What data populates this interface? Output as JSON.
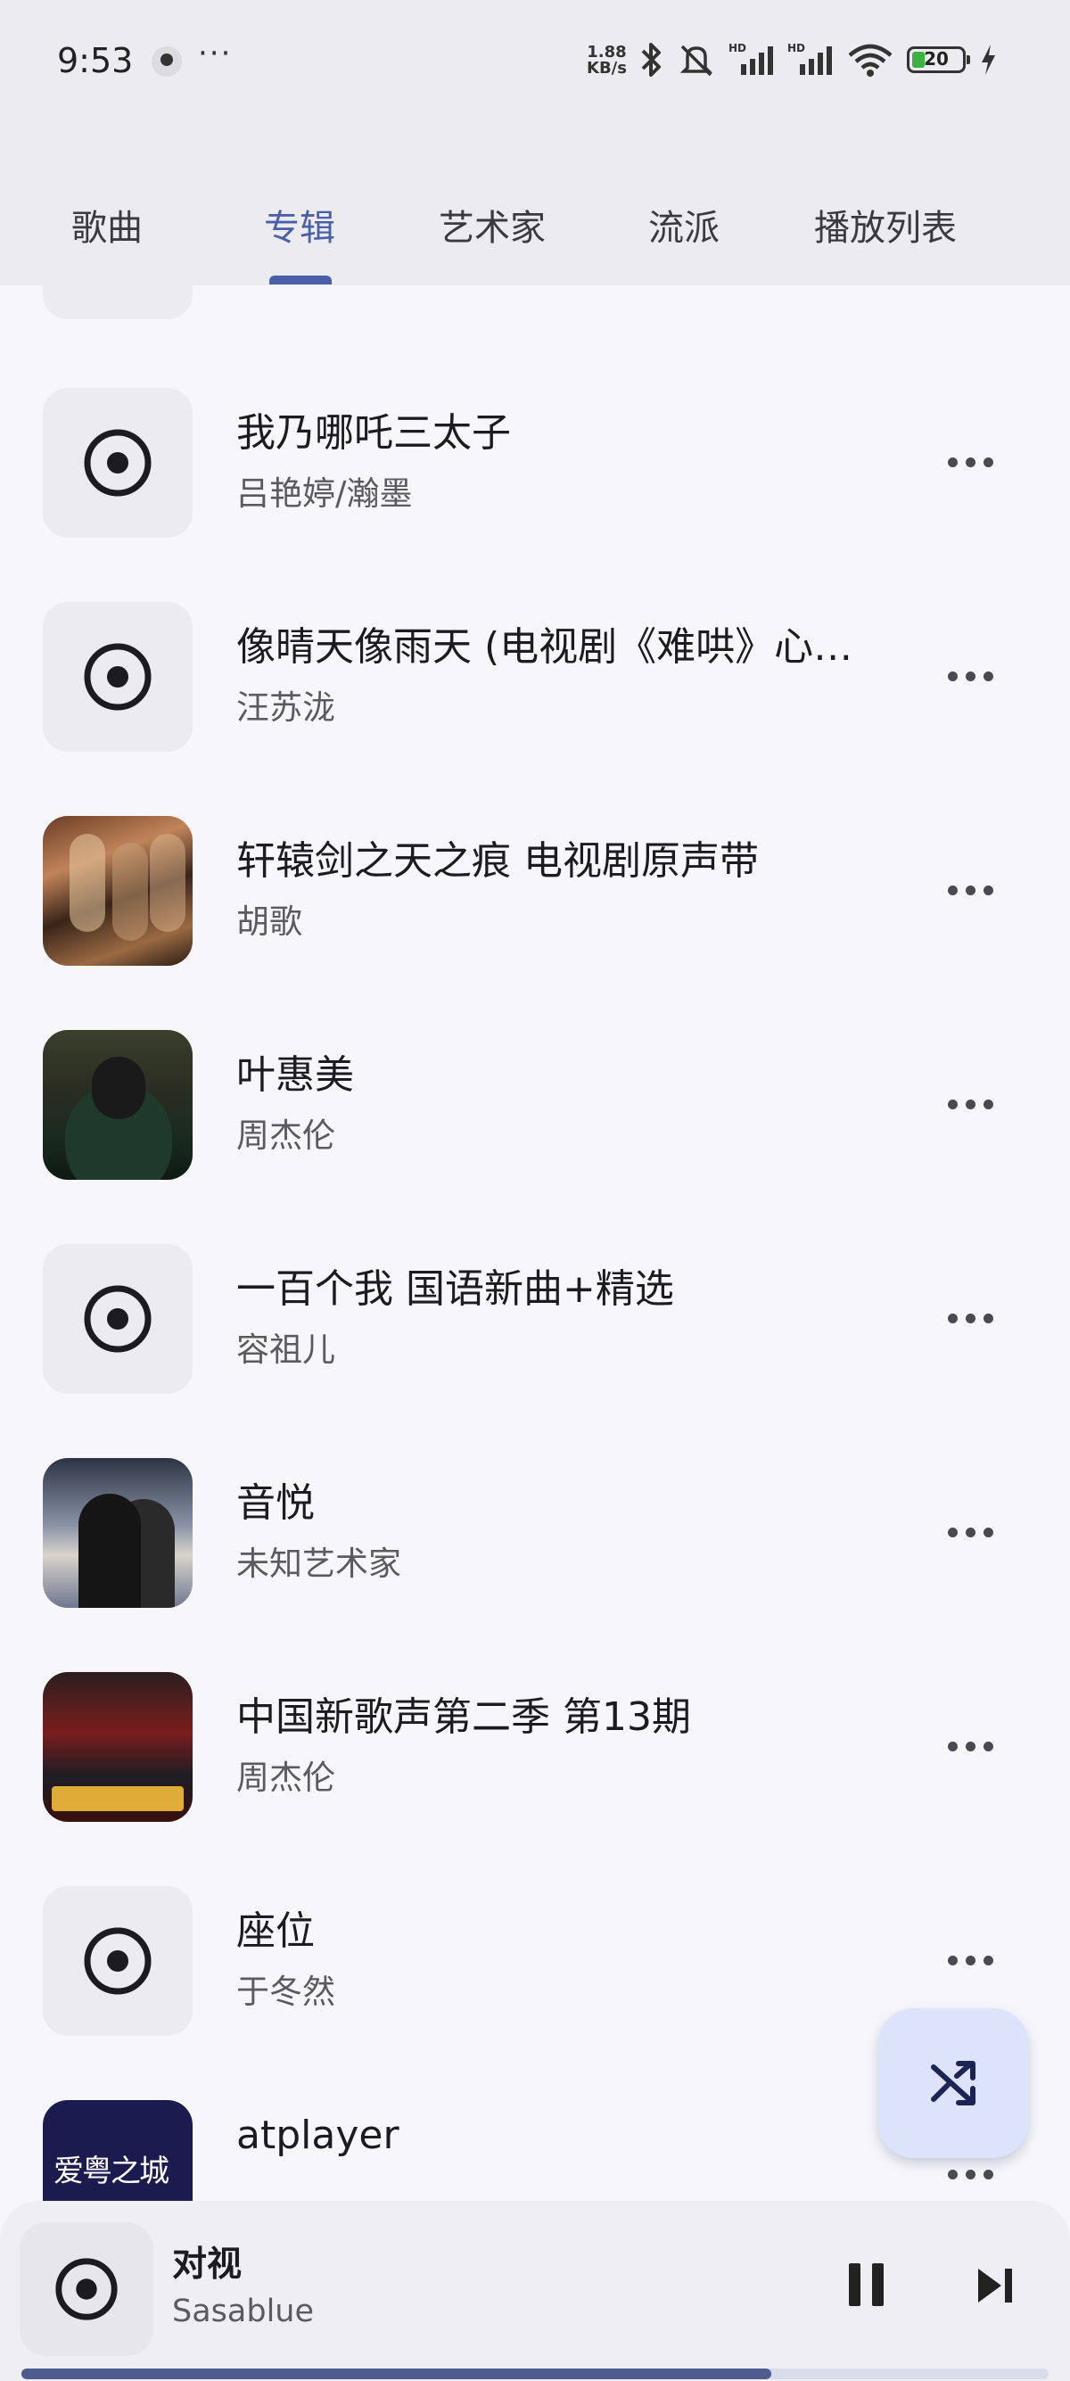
{
  "status_bar": {
    "time": "9:53",
    "dots": "···",
    "net_speed_value": "1.88",
    "net_speed_unit": "KB/s",
    "battery_level": "20",
    "icons": [
      "notification-icon",
      "bluetooth-icon",
      "mute-icon",
      "signal-hd-icon",
      "signal-hd-icon",
      "wifi-icon",
      "battery-icon",
      "charging-icon"
    ]
  },
  "tabs": [
    {
      "label": "歌曲",
      "active": false
    },
    {
      "label": "专辑",
      "active": true
    },
    {
      "label": "艺术家",
      "active": false
    },
    {
      "label": "流派",
      "active": false
    },
    {
      "label": "播放列表",
      "active": false
    }
  ],
  "albums": [
    {
      "title": "我乃哪吒三太子",
      "artist": "吕艳婷/瀚墨",
      "art": "disc-icon"
    },
    {
      "title": "像晴天像雨天 (电视剧《难哄》心…",
      "artist": "汪苏泷",
      "art": "disc-icon"
    },
    {
      "title": "轩辕剑之天之痕 电视剧原声带",
      "artist": "胡歌",
      "art": "album-art"
    },
    {
      "title": "叶惠美",
      "artist": "周杰伦",
      "art": "album-art"
    },
    {
      "title": "一百个我 国语新曲+精选",
      "artist": "容祖儿",
      "art": "disc-icon"
    },
    {
      "title": "音悦",
      "artist": "未知艺术家",
      "art": "album-art"
    },
    {
      "title": "中国新歌声第二季 第13期",
      "artist": "周杰伦",
      "art": "album-art"
    },
    {
      "title": "座位",
      "artist": "于冬然",
      "art": "disc-icon"
    },
    {
      "title": "atplayer",
      "artist": "",
      "art": "album-art",
      "art_text": "爱粤之城"
    }
  ],
  "fab": {
    "icon": "shuffle-icon"
  },
  "now_playing": {
    "title": "对视",
    "artist": "Sasablue",
    "progress": 0.73,
    "accent": "#4f5c8f"
  },
  "colors": {
    "accent": "#4a5fa8",
    "fab_bg": "#dde3fb",
    "background": "#f7f7fb"
  }
}
